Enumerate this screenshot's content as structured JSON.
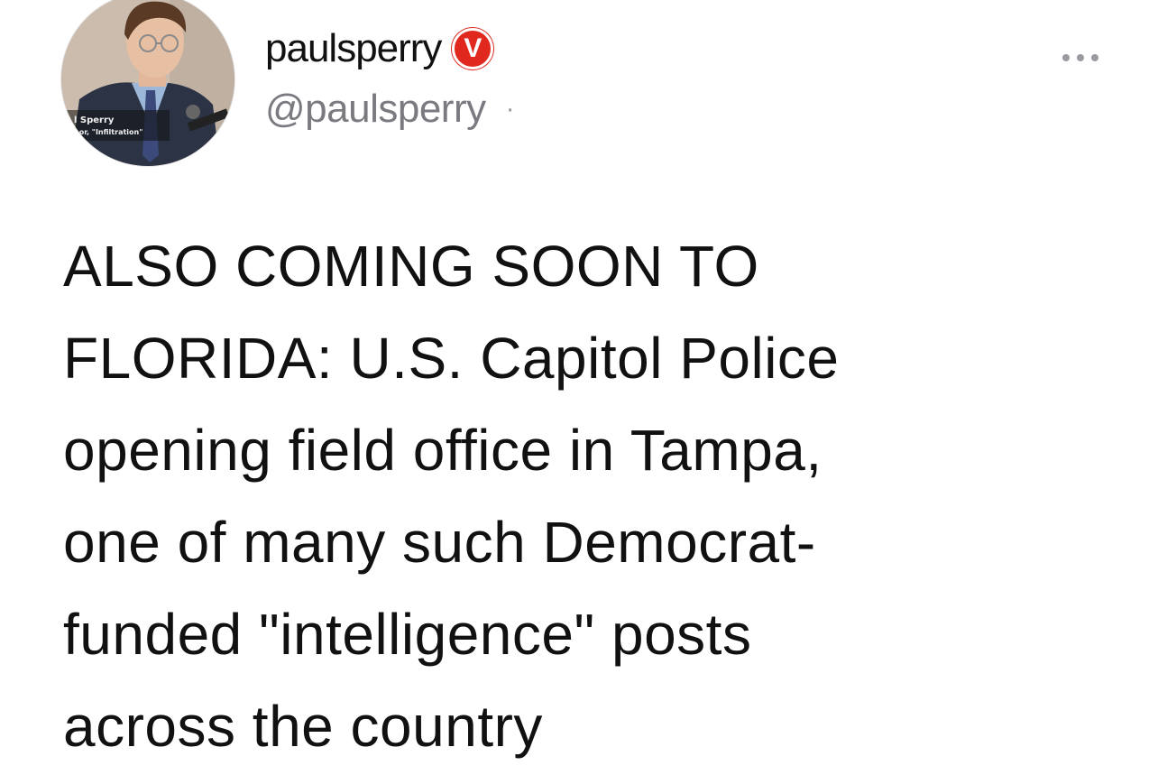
{
  "author": {
    "display_name": "paulsperry",
    "verified_badge_letter": "V",
    "badge_color": "#e0281f",
    "handle": "@paulsperry",
    "separator": "·",
    "avatar": {
      "caption_line1": "l Sperry",
      "caption_line2": "hor, \"Infiltration\""
    }
  },
  "actions": {
    "more_icon": "ellipsis-icon"
  },
  "post": {
    "text": "ALSO COMING SOON TO\nFLORIDA: U.S. Capitol Police\nopening field office in Tampa,\none of many such Democrat-\nfunded \"intelligence\" posts\nacross the country"
  }
}
